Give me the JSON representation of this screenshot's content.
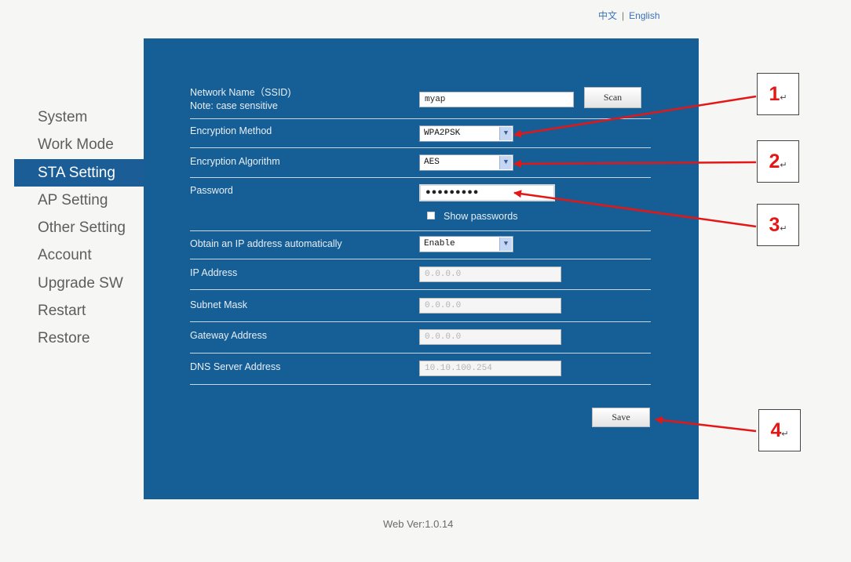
{
  "language": {
    "chinese": "中文",
    "separator": "|",
    "english": "English"
  },
  "sidebar": {
    "items": [
      {
        "label": "System"
      },
      {
        "label": "Work Mode"
      },
      {
        "label": "STA Setting",
        "active": true
      },
      {
        "label": "AP Setting"
      },
      {
        "label": "Other Setting"
      },
      {
        "label": "Account"
      },
      {
        "label": "Upgrade SW"
      },
      {
        "label": "Restart"
      },
      {
        "label": "Restore"
      }
    ]
  },
  "form": {
    "ssid": {
      "label": "Network Name（SSID)",
      "note": "Note: case sensitive",
      "value": "myap",
      "scan_label": "Scan"
    },
    "encryption_method": {
      "label": "Encryption Method",
      "value": "WPA2PSK"
    },
    "encryption_algorithm": {
      "label": "Encryption Algorithm",
      "value": "AES"
    },
    "password": {
      "label": "Password",
      "value": "●●●●●●●●●",
      "show_label": "Show passwords"
    },
    "dhcp": {
      "label": "Obtain an IP address automatically",
      "value": "Enable"
    },
    "ip_address": {
      "label": "IP Address",
      "value": "0.0.0.0"
    },
    "subnet_mask": {
      "label": "Subnet Mask",
      "value": "0.0.0.0"
    },
    "gateway": {
      "label": "Gateway Address",
      "value": "0.0.0.0"
    },
    "dns": {
      "label": "DNS Server Address",
      "value": "10.10.100.254"
    },
    "save_label": "Save"
  },
  "footer": {
    "version": "Web Ver:1.0.14"
  },
  "callouts": [
    {
      "number": "1",
      "mark": "↵"
    },
    {
      "number": "2",
      "mark": "↵"
    },
    {
      "number": "3",
      "mark": "↵"
    },
    {
      "number": "4",
      "mark": "↵"
    }
  ],
  "colors": {
    "panel": "#155f96",
    "active_nav": "#1b5e97",
    "arrow": "#e41616"
  },
  "icons": {
    "dropdown": "chevron-down-icon",
    "callout_arrow": "arrow-left-icon"
  }
}
